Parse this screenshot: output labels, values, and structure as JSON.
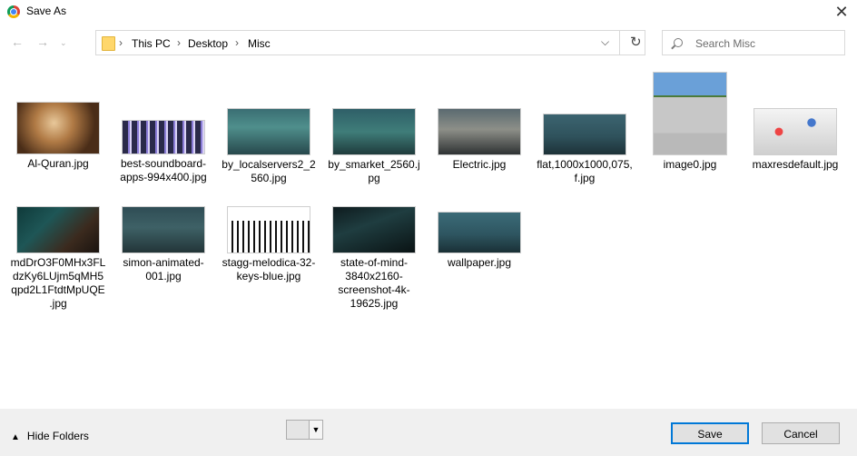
{
  "window": {
    "title": "Save As",
    "app_icon": "chrome-icon",
    "close_icon": "close-icon"
  },
  "nav": {
    "back_icon": "arrow-left-icon",
    "forward_icon": "arrow-right-icon",
    "recent_icon": "chevron-down-icon"
  },
  "address": {
    "folder_icon": "folder-icon",
    "crumbs": [
      "This PC",
      "Desktop",
      "Misc"
    ],
    "dropdown_icon": "chevron-down-icon",
    "refresh_icon": "refresh-icon"
  },
  "search": {
    "placeholder": "Search Misc",
    "value": "",
    "icon": "search-icon"
  },
  "files": [
    {
      "name": "Al-Quran.jpg"
    },
    {
      "name": "best-soundboard-apps-994x400.jpg"
    },
    {
      "name": "by_localservers2_2560.jpg"
    },
    {
      "name": "by_smarket_2560.jpg"
    },
    {
      "name": "Electric.jpg"
    },
    {
      "name": "flat,1000x1000,075,f.jpg"
    },
    {
      "name": "image0.jpg"
    },
    {
      "name": "maxresdefault.jpg"
    },
    {
      "name": "mdDrO3F0MHx3FLdzKy6LUjm5qMH5qpd2L1FtdtMpUQE.jpg"
    },
    {
      "name": "simon-animated-001.jpg"
    },
    {
      "name": "stagg-melodica-32-keys-blue.jpg"
    },
    {
      "name": "state-of-mind-3840x2160-screenshot-4k-19625.jpg"
    },
    {
      "name": "wallpaper.jpg"
    }
  ],
  "footer": {
    "hide_folders_label": "Hide Folders",
    "hide_folders_icon": "chevron-up-icon",
    "save_label": "Save",
    "cancel_label": "Cancel",
    "save_type_dropdown_icon": "chevron-down-icon"
  }
}
